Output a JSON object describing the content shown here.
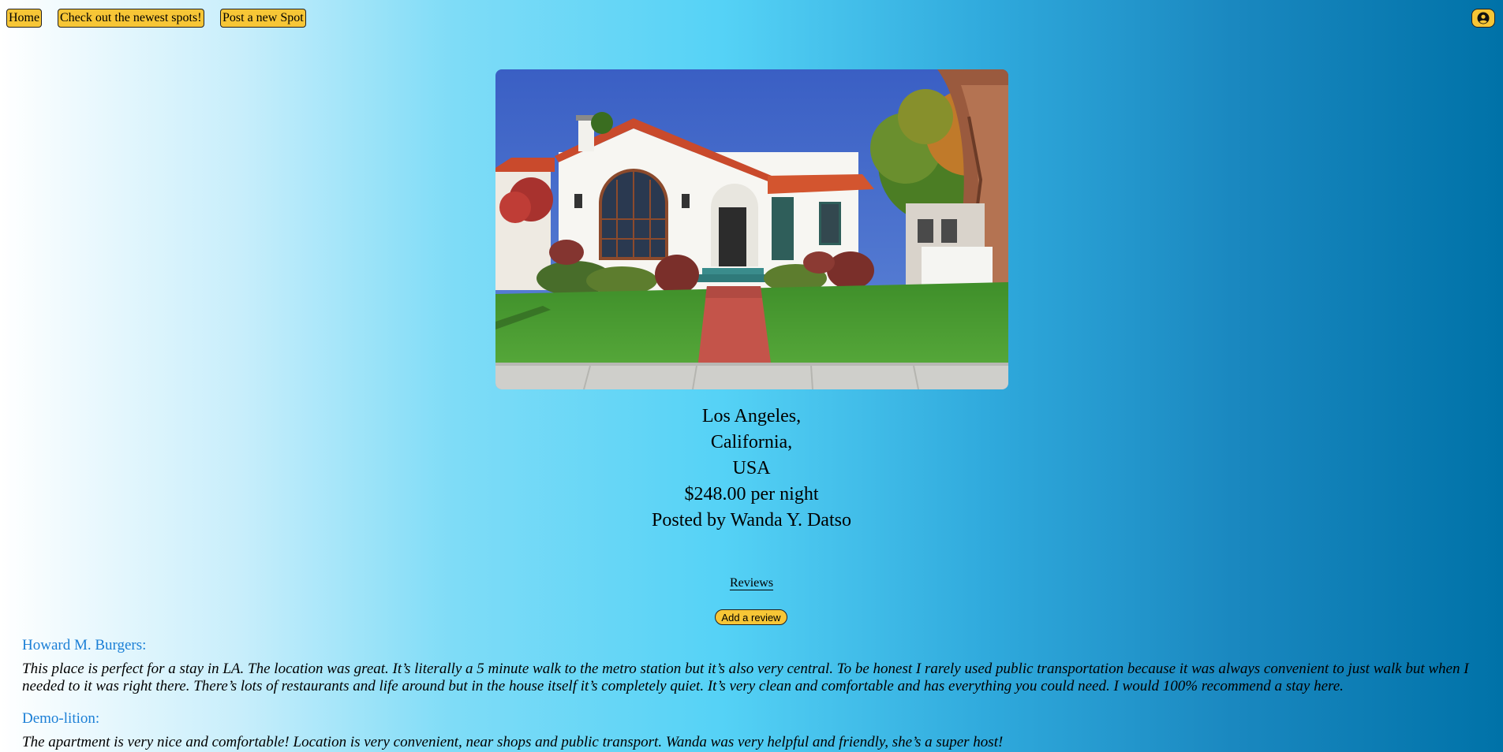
{
  "nav": {
    "home_label": "Home",
    "newest_label": "Check out the newest spots!",
    "post_label": "Post a new Spot",
    "profile_icon": "user-circle-icon"
  },
  "spot": {
    "image_alt": "Spanish-style white house with red tile roof",
    "city": "Los Angeles,",
    "state": "California,",
    "country": "USA",
    "price": "$248.00 per night",
    "posted_by": "Posted by Wanda Y. Datso"
  },
  "reviews": {
    "heading": "Reviews",
    "add_label": "Add a review",
    "items": [
      {
        "author": "Howard M. Burgers:",
        "text": "This place is perfect for a stay in LA. The location was great. It’s literally a 5 minute walk to the metro station but it’s also very central. To be honest I rarely used public transportation because it was always convenient to just walk but when I needed to it was right there. There’s lots of restaurants and life around but in the house itself it’s completely quiet. It’s very clean and comfortable and has everything you could need. I would 100% recommend a stay here."
      },
      {
        "author": "Demo-lition:",
        "text": "The apartment is very nice and comfortable! Location is very convenient, near shops and public transport. Wanda was very helpful and friendly, she’s a super host!"
      }
    ]
  },
  "colors": {
    "button": "#f7c636",
    "author": "#1b7fd6"
  }
}
